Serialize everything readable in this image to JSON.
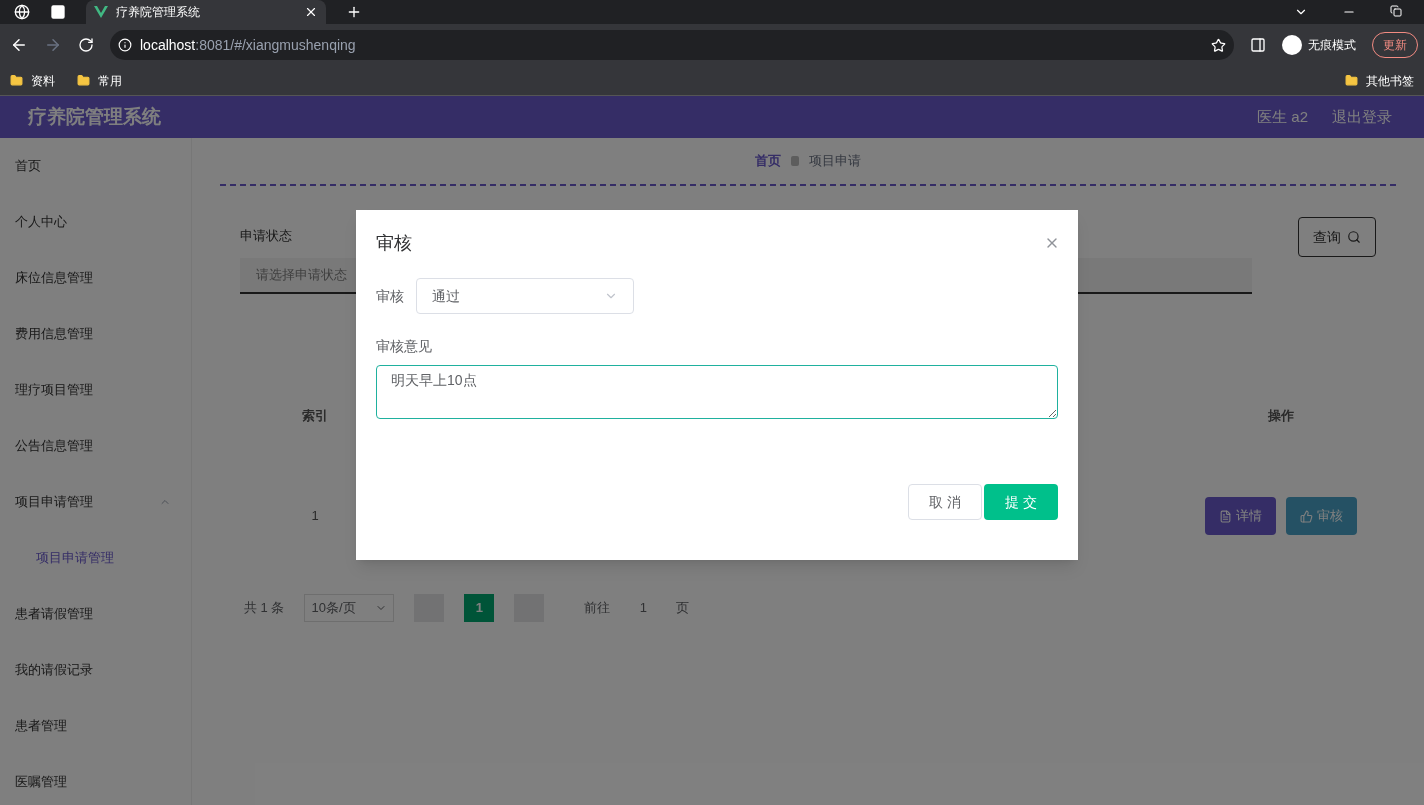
{
  "browser": {
    "tab_title": "疗养院管理系统",
    "url_host": "localhost",
    "url_rest": ":8081/#/xiangmushenqing",
    "incognito_label": "无痕模式",
    "update_button": "更新",
    "bookmarks": [
      "资料",
      "常用"
    ],
    "other_bookmarks": "其他书签"
  },
  "header": {
    "title": "疗养院管理系统",
    "user": "医生 a2",
    "logout": "退出登录"
  },
  "sidebar": {
    "items": [
      {
        "label": "首页",
        "selected": false
      },
      {
        "label": "个人中心",
        "selected": false
      },
      {
        "label": "床位信息管理",
        "selected": false
      },
      {
        "label": "费用信息管理",
        "selected": false
      },
      {
        "label": "理疗项目管理",
        "selected": false
      },
      {
        "label": "公告信息管理",
        "selected": false
      },
      {
        "label": "项目申请管理",
        "selected": false,
        "expanded": true,
        "children": [
          {
            "label": "项目申请管理",
            "selected": true
          }
        ]
      },
      {
        "label": "患者请假管理",
        "selected": false
      },
      {
        "label": "我的请假记录",
        "selected": false
      },
      {
        "label": "患者管理",
        "selected": false
      },
      {
        "label": "医嘱管理",
        "selected": false
      }
    ]
  },
  "breadcrumb": [
    "首页",
    "项目申请"
  ],
  "filter": {
    "label": "申请状态",
    "placeholder": "请选择申请状态",
    "search_button": "查询"
  },
  "table": {
    "columns": [
      "索引",
      "操作"
    ],
    "rows": [
      {
        "index": "1",
        "actions": [
          "详情",
          "审核"
        ]
      }
    ]
  },
  "pagination": {
    "total": "共 1 条",
    "page_size": "10条/页",
    "pages": [
      {
        "label": "1",
        "selected": true
      }
    ],
    "goto_label": "前往",
    "goto_value": "1",
    "goto_suffix": "页"
  },
  "dialog": {
    "title": "审核",
    "result_label": "审核",
    "result_value": "通过",
    "opinion_label": "审核意见",
    "opinion_value": "明天早上10点",
    "cancel": "取 消",
    "submit": "提 交"
  }
}
